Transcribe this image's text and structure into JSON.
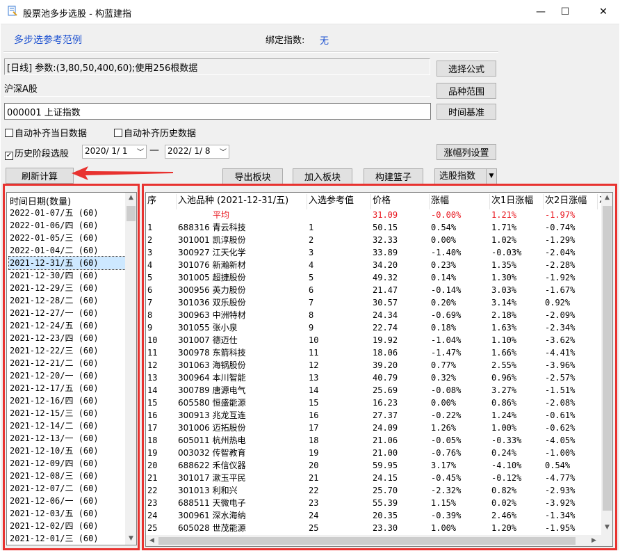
{
  "window": {
    "title": "股票池多步选股 - 构蓝建指",
    "min_glyph": "—",
    "max_glyph": "☐",
    "close_glyph": "✕"
  },
  "header": {
    "ref_link": "多步选参考范例",
    "bind_label": "绑定指数:",
    "bind_value": "无"
  },
  "formula_info": "[日线] 参数:(3,80,50,400,60);使用256根数据",
  "market_info": "沪深A股",
  "index_input": "000001 上证指数",
  "buttons": {
    "select_formula": "选择公式",
    "stock_range": "品种范围",
    "time_base": "时间基准",
    "column_settings": "涨幅列设置",
    "refresh": "刷新计算",
    "export": "导出板块",
    "add": "加入板块",
    "build_basket": "构建篮子",
    "pick_index": "选股指数"
  },
  "checkboxes": {
    "auto_today": "自动补齐当日数据",
    "auto_history": "自动补齐历史数据",
    "history_stage": "历史阶段选股",
    "check_glyph": "✓"
  },
  "dates": {
    "start": "2020/ 1/ 1",
    "end": "2022/ 1/ 8",
    "dash": "—"
  },
  "date_list": {
    "header": "时间日期(数量)",
    "items": [
      "2022-01-07/五  (60)",
      "2022-01-06/四  (60)",
      "2022-01-05/三  (60)",
      "2022-01-04/二  (60)",
      "2021-12-31/五  (60)",
      "2021-12-30/四  (60)",
      "2021-12-29/三  (60)",
      "2021-12-28/二  (60)",
      "2021-12-27/一  (60)",
      "2021-12-24/五  (60)",
      "2021-12-23/四  (60)",
      "2021-12-22/三  (60)",
      "2021-12-21/二  (60)",
      "2021-12-20/一  (60)",
      "2021-12-17/五  (60)",
      "2021-12-16/四  (60)",
      "2021-12-15/三  (60)",
      "2021-12-14/二  (60)",
      "2021-12-13/一  (60)",
      "2021-12-10/五  (60)",
      "2021-12-09/四  (60)",
      "2021-12-08/三  (60)",
      "2021-12-07/二  (60)",
      "2021-12-06/一  (60)",
      "2021-12-03/五  (60)",
      "2021-12-02/四  (60)",
      "2021-12-01/三  (60)"
    ],
    "selected_index": 4
  },
  "grid": {
    "headers": [
      "序",
      "入池品种 (2021-12-31/五)",
      "入选参考值",
      "价格",
      "涨幅",
      "次1日涨幅",
      "次2日涨幅",
      "次"
    ],
    "avg_row": {
      "label": "平均",
      "price": "31.09",
      "change": "-0.00%",
      "next1": "1.21%",
      "next2": "-1.97%"
    },
    "rows": [
      [
        "1",
        "688316 青云科技",
        "1",
        "50.15",
        "0.54%",
        "1.71%",
        "-0.74%"
      ],
      [
        "2",
        "301001 凯淳股份",
        "2",
        "32.33",
        "0.00%",
        "1.02%",
        "-1.29%"
      ],
      [
        "3",
        "300927 江天化学",
        "3",
        "33.89",
        "-1.40%",
        "-0.03%",
        "-2.04%"
      ],
      [
        "4",
        "301076 新瀚新材",
        "4",
        "34.20",
        "0.23%",
        "1.35%",
        "-2.28%"
      ],
      [
        "5",
        "301005 超捷股份",
        "5",
        "49.32",
        "0.14%",
        "1.30%",
        "-1.92%"
      ],
      [
        "6",
        "300956 英力股份",
        "6",
        "21.47",
        "-0.14%",
        "3.03%",
        "-1.67%"
      ],
      [
        "7",
        "301036 双乐股份",
        "7",
        "30.57",
        "0.20%",
        "3.14%",
        "0.92%"
      ],
      [
        "8",
        "300963 中洲特材",
        "8",
        "24.34",
        "-0.69%",
        "2.18%",
        "-2.09%"
      ],
      [
        "9",
        "301055 张小泉",
        "9",
        "22.74",
        "0.18%",
        "1.63%",
        "-2.34%"
      ],
      [
        "10",
        "301007 德迈仕",
        "10",
        "19.92",
        "-1.04%",
        "1.10%",
        "-3.62%"
      ],
      [
        "11",
        "300978 东箭科技",
        "11",
        "18.06",
        "-1.47%",
        "1.66%",
        "-4.41%"
      ],
      [
        "12",
        "301063 海锅股份",
        "12",
        "39.20",
        "0.77%",
        "2.55%",
        "-3.96%"
      ],
      [
        "13",
        "300964 本川智能",
        "13",
        "40.79",
        "0.32%",
        "0.96%",
        "-2.57%"
      ],
      [
        "14",
        "300789 唐源电气",
        "14",
        "25.69",
        "-0.08%",
        "3.27%",
        "-1.51%"
      ],
      [
        "15",
        "605580 恒盛能源",
        "15",
        "16.23",
        "0.00%",
        "0.86%",
        "-2.08%"
      ],
      [
        "16",
        "300913 兆龙互连",
        "16",
        "27.37",
        "-0.22%",
        "1.24%",
        "-0.61%"
      ],
      [
        "17",
        "301006 迈拓股份",
        "17",
        "24.09",
        "1.26%",
        "1.00%",
        "-0.62%"
      ],
      [
        "18",
        "605011 杭州热电",
        "18",
        "21.06",
        "-0.05%",
        "-0.33%",
        "-4.05%"
      ],
      [
        "19",
        "003032 传智教育",
        "19",
        "21.00",
        "-0.76%",
        "0.24%",
        "-1.00%"
      ],
      [
        "20",
        "688622 禾信仪器",
        "20",
        "59.95",
        "3.17%",
        "-4.10%",
        "0.54%"
      ],
      [
        "21",
        "301017 漱玉平民",
        "21",
        "24.15",
        "-0.45%",
        "-0.12%",
        "-4.77%"
      ],
      [
        "22",
        "301013 利和兴",
        "22",
        "25.70",
        "-2.32%",
        "0.82%",
        "-2.93%"
      ],
      [
        "23",
        "688511 天微电子",
        "23",
        "55.39",
        "1.15%",
        "0.02%",
        "-3.92%"
      ],
      [
        "24",
        "300961 深水海纳",
        "24",
        "20.35",
        "-0.39%",
        "2.46%",
        "-1.34%"
      ],
      [
        "25",
        "605028 世茂能源",
        "25",
        "23.30",
        "1.00%",
        "1.20%",
        "-1.95%"
      ]
    ]
  },
  "colors": {
    "highlight": "#e8322f",
    "link": "#1a4fd0",
    "negative": "#e8141c",
    "selection": "#cde8ff"
  }
}
